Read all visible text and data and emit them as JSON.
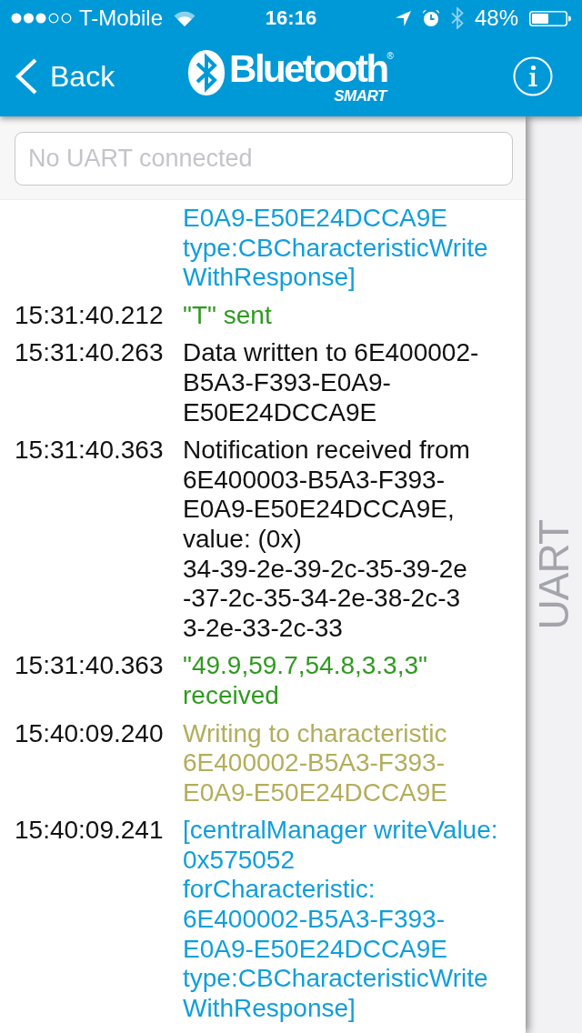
{
  "status_bar": {
    "carrier": "T-Mobile",
    "time": "16:16",
    "battery_percent": "48%"
  },
  "nav_bar": {
    "back_label": "Back",
    "logo": {
      "wordmark": "Bluetooth",
      "registered": "®",
      "tagline": "SMART"
    }
  },
  "uart_field": {
    "placeholder": "No UART connected"
  },
  "log": [
    {
      "kind": "api",
      "lines": [
        "E0A9-E50E24DCCA9E",
        "type:CBCharacteristicWrite",
        "WithResponse]"
      ]
    },
    {
      "time": "15:31:40.212",
      "kind": "uart",
      "lines": [
        "\"T\" sent"
      ]
    },
    {
      "time": "15:31:40.263",
      "kind": "event",
      "lines": [
        "Data written to 6E400002-",
        "B5A3-F393-E0A9-",
        "E50E24DCCA9E"
      ]
    },
    {
      "time": "15:31:40.363",
      "kind": "event",
      "lines": [
        "Notification received from",
        "6E400003-B5A3-F393-",
        "E0A9-E50E24DCCA9E,",
        "value: (0x)",
        "34-39-2e-39-2c-35-39-2e",
        "-37-2c-35-34-2e-38-2c-3",
        "3-2e-33-2c-33"
      ]
    },
    {
      "time": "15:31:40.363",
      "kind": "uart",
      "lines": [
        "\"49.9,59.7,54.8,3.3,3\"",
        "received"
      ]
    },
    {
      "time": "15:40:09.240",
      "kind": "action",
      "lines": [
        "Writing to characteristic",
        "6E400002-B5A3-F393-",
        "E0A9-E50E24DCCA9E"
      ]
    },
    {
      "time": "15:40:09.241",
      "kind": "api",
      "lines": [
        "[centralManager writeValue:",
        "0x575052",
        "forCharacteristic:",
        "6E400002-B5A3-F393-",
        "E0A9-E50E24DCCA9E",
        "type:CBCharacteristicWrite",
        "WithResponse]"
      ]
    }
  ],
  "side_panel": {
    "label": "UART"
  }
}
